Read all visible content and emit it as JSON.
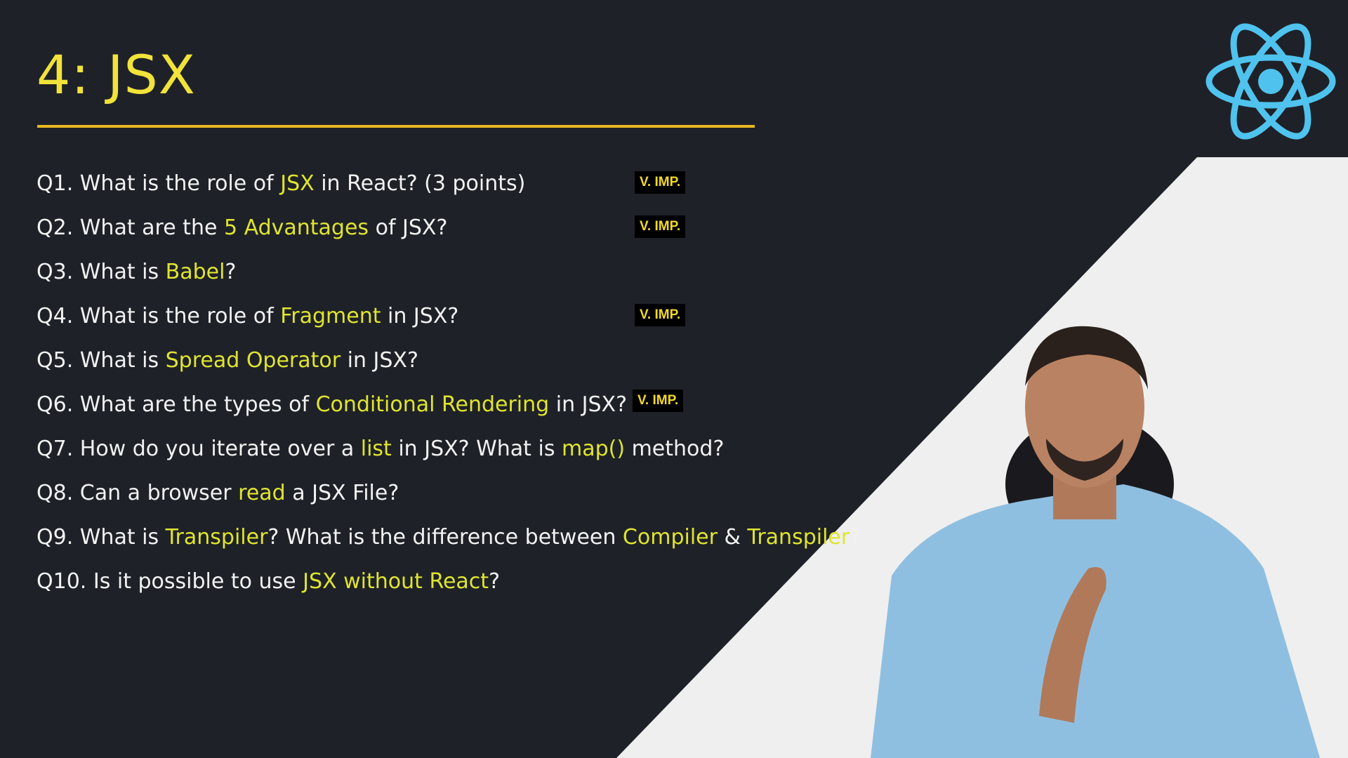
{
  "slide": {
    "title": "4: JSX",
    "colors": {
      "background": "#1f2128",
      "highlight": "#dfe52f",
      "title": "#f1e33a",
      "underline": "#e8b622",
      "logo": "#4fc3ee"
    },
    "logo_icon": "react-atom-icon",
    "badge_label": "V. IMP.",
    "questions": [
      {
        "parts": [
          {
            "t": "Q1. What is the role of "
          },
          {
            "t": "JSX",
            "hl": true
          },
          {
            "t": " in React? (3 points)"
          }
        ],
        "badge": "V. IMP."
      },
      {
        "parts": [
          {
            "t": "Q2. What are the "
          },
          {
            "t": "5 Advantages",
            "hl": true
          },
          {
            "t": " of JSX?"
          }
        ],
        "badge": "V. IMP."
      },
      {
        "parts": [
          {
            "t": "Q3. What is "
          },
          {
            "t": "Babel",
            "hl": true
          },
          {
            "t": "?"
          }
        ]
      },
      {
        "parts": [
          {
            "t": "Q4. What is the role of "
          },
          {
            "t": "Fragment",
            "hl": true
          },
          {
            "t": " in JSX?"
          }
        ],
        "badge": "V. IMP."
      },
      {
        "parts": [
          {
            "t": "Q5. What is "
          },
          {
            "t": "Spread Operator",
            "hl": true
          },
          {
            "t": " in JSX?"
          }
        ]
      },
      {
        "parts": [
          {
            "t": "Q6. What are the types of "
          },
          {
            "t": "Conditional Rendering",
            "hl": true
          },
          {
            "t": " in JSX?"
          }
        ],
        "badge": "V. IMP."
      },
      {
        "parts": [
          {
            "t": "Q7. How do you iterate over a "
          },
          {
            "t": "list",
            "hl": true
          },
          {
            "t": " in JSX? What is "
          },
          {
            "t": "map()",
            "hl": true
          },
          {
            "t": " method?"
          }
        ]
      },
      {
        "parts": [
          {
            "t": "Q8. Can a browser "
          },
          {
            "t": "read",
            "hl": true
          },
          {
            "t": " a JSX File?"
          }
        ]
      },
      {
        "parts": [
          {
            "t": "Q9. What is "
          },
          {
            "t": "Transpiler",
            "hl": true
          },
          {
            "t": "? What is the difference between "
          },
          {
            "t": "Compiler",
            "hl": true
          },
          {
            "t": " & "
          },
          {
            "t": "Transpiler",
            "hl": true
          },
          {
            "t": "?"
          }
        ]
      },
      {
        "parts": [
          {
            "t": "Q10. Is it possible to use "
          },
          {
            "t": "JSX without React",
            "hl": true
          },
          {
            "t": "?"
          }
        ]
      }
    ]
  }
}
